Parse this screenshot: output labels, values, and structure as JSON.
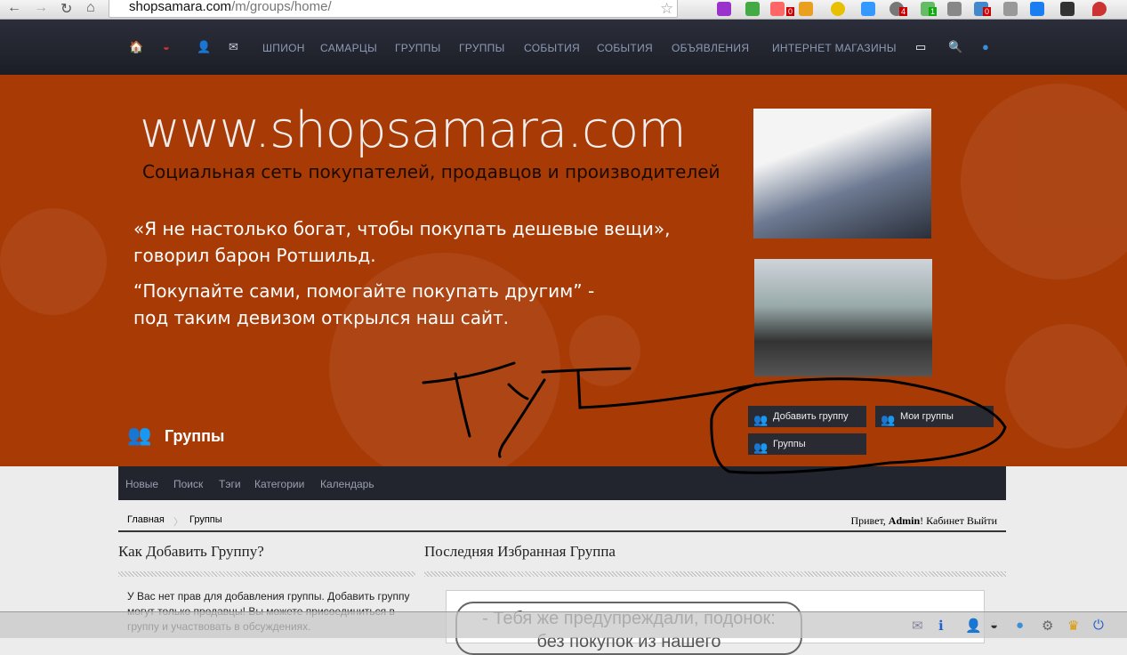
{
  "browser": {
    "url_host": "shopsamara.com",
    "url_path": "/m/groups/home/",
    "back": "←",
    "forward": "→",
    "reload": "↻",
    "home": "⌂"
  },
  "extension_badges": [
    "0",
    "4",
    "1",
    "0"
  ],
  "topnav": {
    "items": [
      "ШПИОН",
      "САМАРЦЫ",
      "ГРУППЫ",
      "ГРУППЫ",
      "СОБЫТИЯ",
      "СОБЫТИЯ",
      "ОБЪЯВЛЕНИЯ",
      "ИНТЕРНЕТ МАГАЗИНЫ"
    ]
  },
  "banner": {
    "site": "www.shopsamara.com",
    "tagline": "Социальная сеть покупателей, продавцов и производителей",
    "quote1_line1": "«Я не настолько богат, чтобы покупать дешевые вещи»,",
    "quote1_line2": " говорил барон Ротшильд.",
    "quote2_line1": "“Покупайте сами, помогайте покупать другим” -",
    "quote2_line2": "под таким девизом открылся наш сайт."
  },
  "page": {
    "title": "Группы",
    "buttons": {
      "add": "Добавить группу",
      "mine": "Мои группы",
      "all": "Группы"
    }
  },
  "annotation": "Ту",
  "subnav": [
    "Новые",
    "Поиск",
    "Тэги",
    "Категории",
    "Календарь"
  ],
  "breadcrumb": {
    "home": "Главная",
    "current": "Группы"
  },
  "user": {
    "greeting": "Привет,",
    "name": "Admin",
    "bang": "!",
    "cabinet": "Кабинет",
    "logout": "Выйти"
  },
  "left": {
    "heading": "Как Добавить Группу?",
    "text": "У Вас нет прав для добавления группы. Добавить группу могут только продавцы! Вы можете присоединиться в группу и участвовать в обсуждениях."
  },
  "right": {
    "heading": "Последняя Избранная Группа",
    "bubble_line1": "- Тебя же предупреждали, подонок:",
    "bubble_line2": "без покупок из нашего"
  }
}
